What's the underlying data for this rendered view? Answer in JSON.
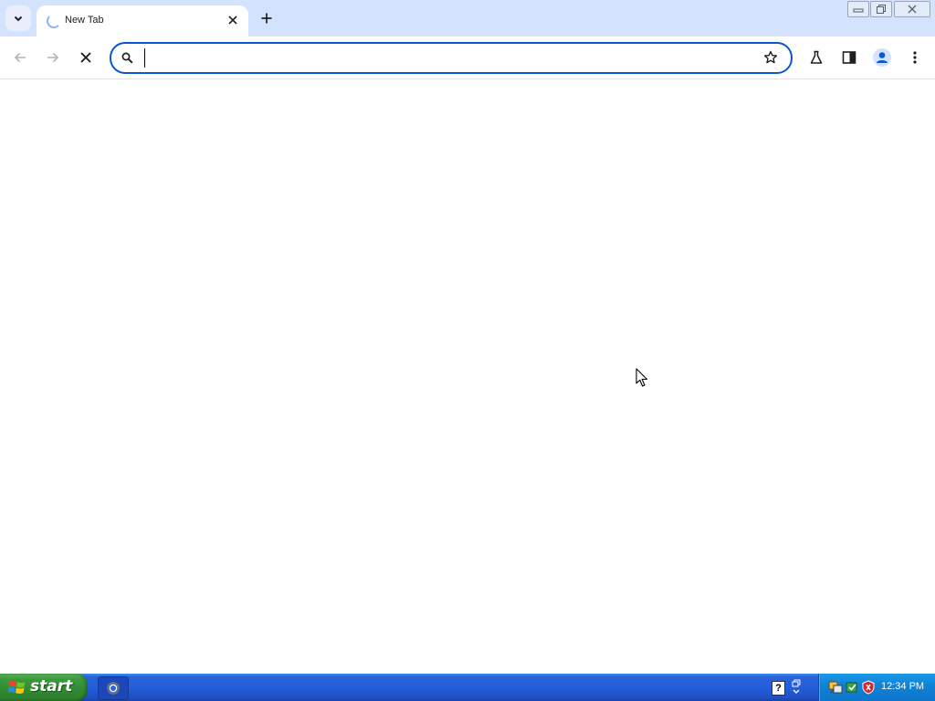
{
  "browser": {
    "tab": {
      "title": "New Tab"
    },
    "omnibox": {
      "value": "",
      "placeholder": ""
    }
  },
  "taskbar": {
    "start_label": "start",
    "clock": "12:34 PM"
  },
  "colors": {
    "tabstrip_bg": "#d3e3fd",
    "omnibox_border": "#0b57d0",
    "taskbar_blue": "#245edb",
    "start_green": "#3c9a3c",
    "tray_blue": "#0f83d9"
  },
  "icons": [
    "chevron-down-icon",
    "loading-spinner-icon",
    "close-icon",
    "plus-icon",
    "minimize-icon",
    "restore-icon",
    "window-close-icon",
    "back-arrow-icon",
    "forward-arrow-icon",
    "stop-icon",
    "search-icon",
    "bookmark-star-icon",
    "labs-flask-icon",
    "side-panel-icon",
    "profile-icon",
    "more-menu-icon",
    "windows-flag-icon",
    "chrome-icon",
    "help-icon",
    "tray-toggle-icon",
    "network-icon",
    "update-icon",
    "security-shield-icon",
    "mouse-pointer-icon"
  ]
}
